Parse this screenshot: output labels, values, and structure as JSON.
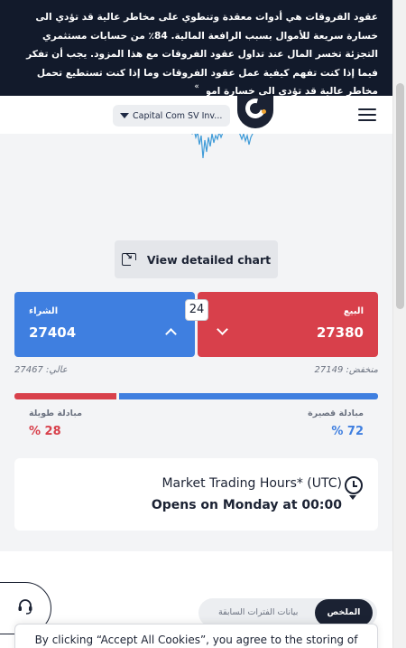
{
  "risk_warning": {
    "text": "عقود الفروقات هي أدوات معقدة وتنطوي على مخاطر عالية قد تؤدي الى خسارة سريعة للأموال بسبب الرافعة المالية. 84٪ من حسابات مستثمري التجزئة تخسر المال عند تداول عقود الفروقات مع هذا المزود. يجب أن تفكر فيما إذا كنت تفهم كيفية عمل عقود الفروقات وما إذا كنت تستطيع تحمل مخاطر عالية قد تؤدي الى خسارة اموالك.",
    "collapse_icon": "double-chevron-up-icon"
  },
  "header": {
    "instrument": "Capital Com SV Inv...",
    "logo": "capital-com-logo",
    "menu_icon": "hamburger-icon"
  },
  "chart": {
    "detail_button_label": "View detailed chart",
    "detail_icon": "expand-chart-icon"
  },
  "trade": {
    "buy_label": "الشراء",
    "buy_price": "27404",
    "sell_label": "البيع",
    "sell_price": "27380",
    "spread": "24",
    "high_text": "عالي: 27467",
    "low_text": "منخفض: 27149"
  },
  "sentiment": {
    "long_label": "مبادلة طويلة",
    "long_value": "% 28",
    "long_fraction": 0.28,
    "short_label": "مبادلة قصيرة",
    "short_value": "% 72",
    "short_fraction": 0.72,
    "long_color": "#d8404b",
    "short_color": "#3f7fe0"
  },
  "market_hours": {
    "title": "Market Trading Hours* (UTC)",
    "status": "Opens on Monday at 00:00",
    "icon": "clock-icon"
  },
  "tabs": {
    "active": "الملخص",
    "inactive": "بيانات الفترات السابقة"
  },
  "support": {
    "icon": "headset-icon"
  },
  "cookie": {
    "text": "By clicking “Accept All Cookies”, you agree to the storing of"
  },
  "colors": {
    "brand_dark": "#121a2b",
    "buy": "#3f7fe0",
    "sell": "#d8404b"
  }
}
